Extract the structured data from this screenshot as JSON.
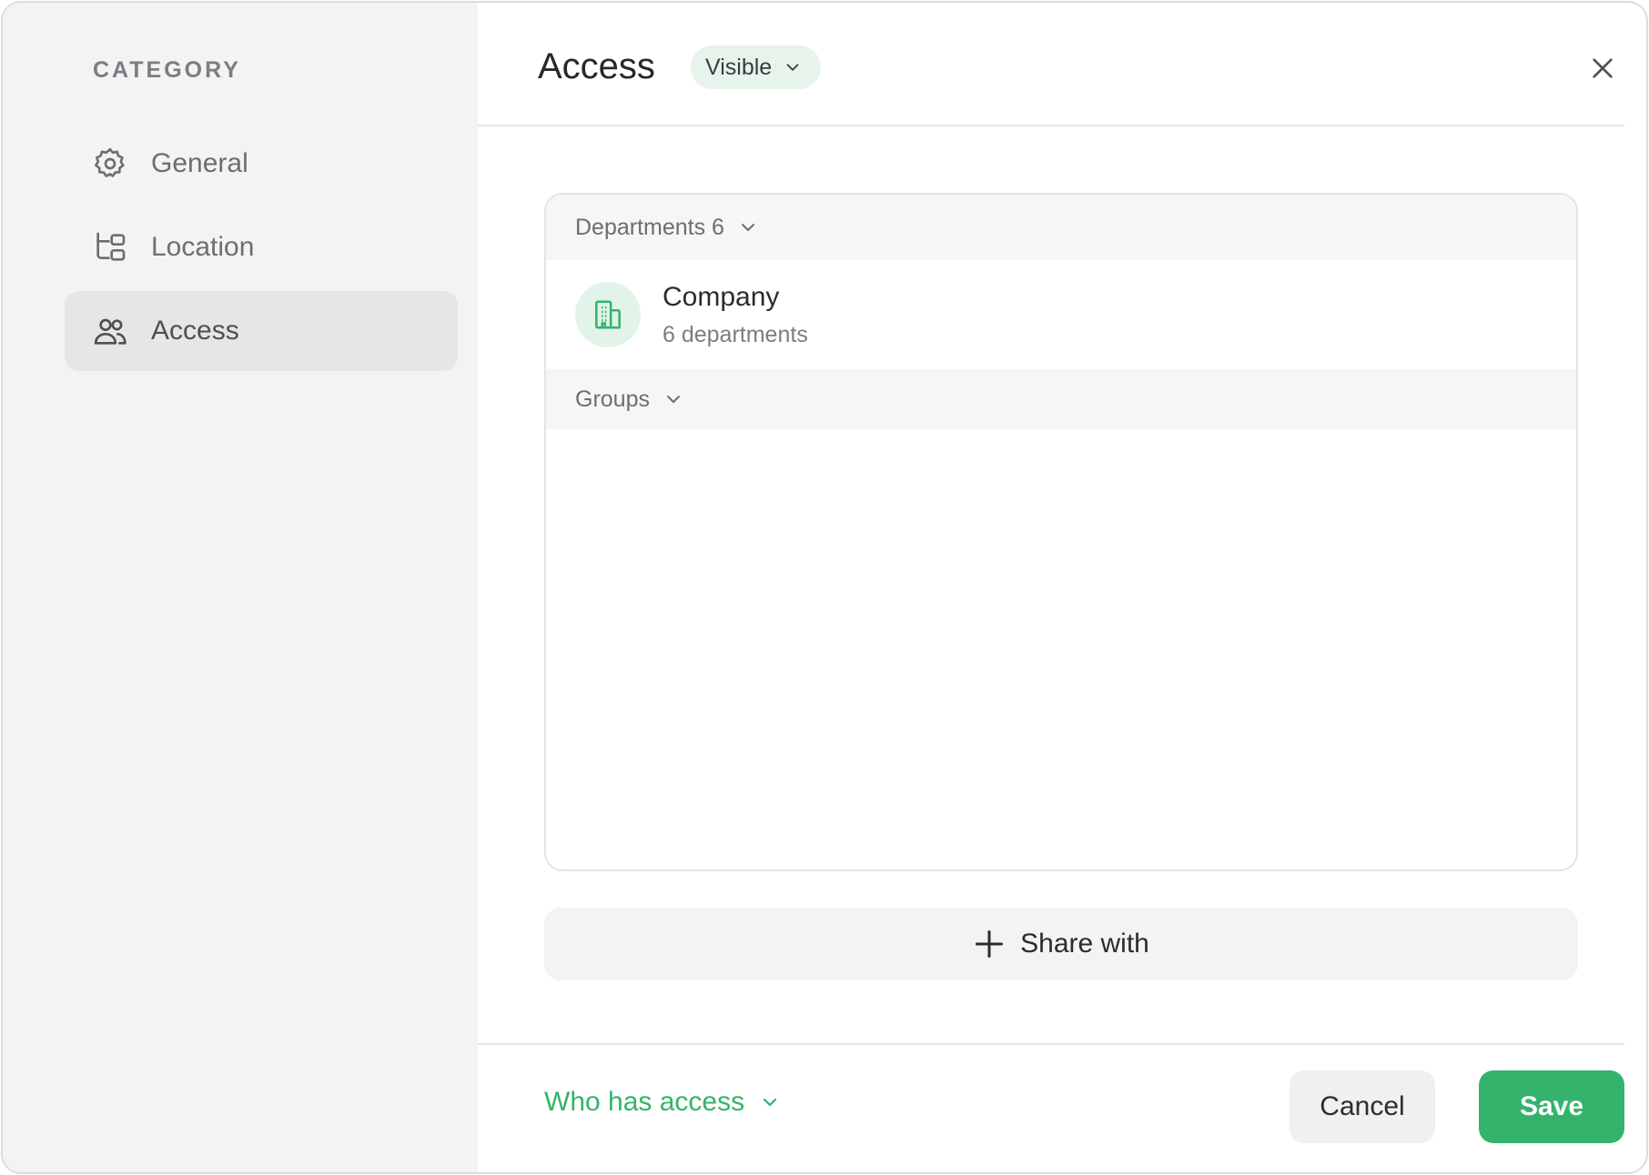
{
  "sidebar": {
    "heading": "CATEGORY",
    "items": [
      {
        "label": "General",
        "icon": "gear-icon"
      },
      {
        "label": "Location",
        "icon": "tree-structure-icon"
      },
      {
        "label": "Access",
        "icon": "users-icon",
        "active": true
      }
    ]
  },
  "header": {
    "title": "Access",
    "visibility": "Visible"
  },
  "panel": {
    "departments_header": "Departments 6",
    "department": {
      "name": "Company",
      "subtitle": "6 departments",
      "icon": "building-icon"
    },
    "groups_header": "Groups"
  },
  "share_label": "Share with",
  "footer": {
    "who_has_access": "Who has access",
    "cancel_label": "Cancel",
    "save_label": "Save"
  },
  "colors": {
    "accent": "#34b36c",
    "sidebar_bg": "#f3f3f3",
    "chip_bg": "#e6f4ec"
  }
}
